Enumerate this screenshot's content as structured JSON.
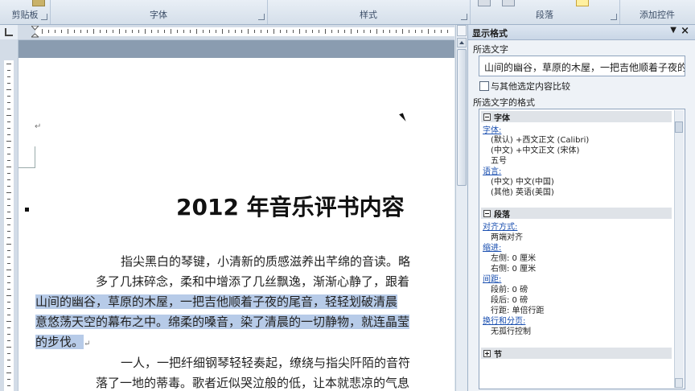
{
  "ribbon": {
    "groups": [
      {
        "label": "剪贴板"
      },
      {
        "label": "字体"
      },
      {
        "label": "样式"
      },
      {
        "label": "段落"
      },
      {
        "label": "添加控件"
      }
    ]
  },
  "document": {
    "title": "2012 年音乐评书内容",
    "lines": [
      "指尖黑白的琴键，小清新的质感滋养出芊绵的音读。略",
      "多了几抹碎念，柔和中增添了几丝飘逸，渐渐心静了，跟着",
      "山间的幽谷，草原的木屋，一把吉他顺着子夜的尾音，轻轻划破清晨",
      "意悠荡天空的幕布之中。绵柔的嗓音，染了清晨的一切静物，就连晶莹",
      "的步伐。",
      "一人，一把纤细钢琴轻轻奏起，缭绕与指尖阡陌的音符",
      "落了一地的蒂毒。歌者近似哭泣般的低，让本就悲凉的气息"
    ]
  },
  "pane": {
    "title": "显示格式",
    "selected_text_label": "所选文字",
    "selected_text": "山间的幽谷，草原的木屋，一把吉他顺着子夜的",
    "compare_label": "与其他选定内容比较",
    "format_label": "所选文字的格式",
    "sections": {
      "font": {
        "header": "字体",
        "font_link": "字体:",
        "default_font": "(默认) +西文正文 (Calibri)",
        "cn_font": "(中文) +中文正文 (宋体)",
        "size": "五号",
        "lang_link": "语言:",
        "lang_cn": "(中文) 中文(中国)",
        "lang_other": "(其他) 英语(美国)"
      },
      "paragraph": {
        "header": "段落",
        "align_link": "对齐方式:",
        "align_value": "两端对齐",
        "indent_link": "缩进:",
        "left_indent": "左侧:   0 厘米",
        "right_indent": "右侧:   0 厘米",
        "spacing_link": "间距:",
        "before": "段前:  0 磅",
        "after": "段后:  0 磅",
        "line": "行距:  单倍行距",
        "pagination_link": "换行和分页:",
        "pagination_value": "无孤行控制"
      },
      "section": {
        "header": "节"
      }
    }
  },
  "colors": {
    "selection": "#b7cbe8",
    "link": "#1a4fb0"
  }
}
